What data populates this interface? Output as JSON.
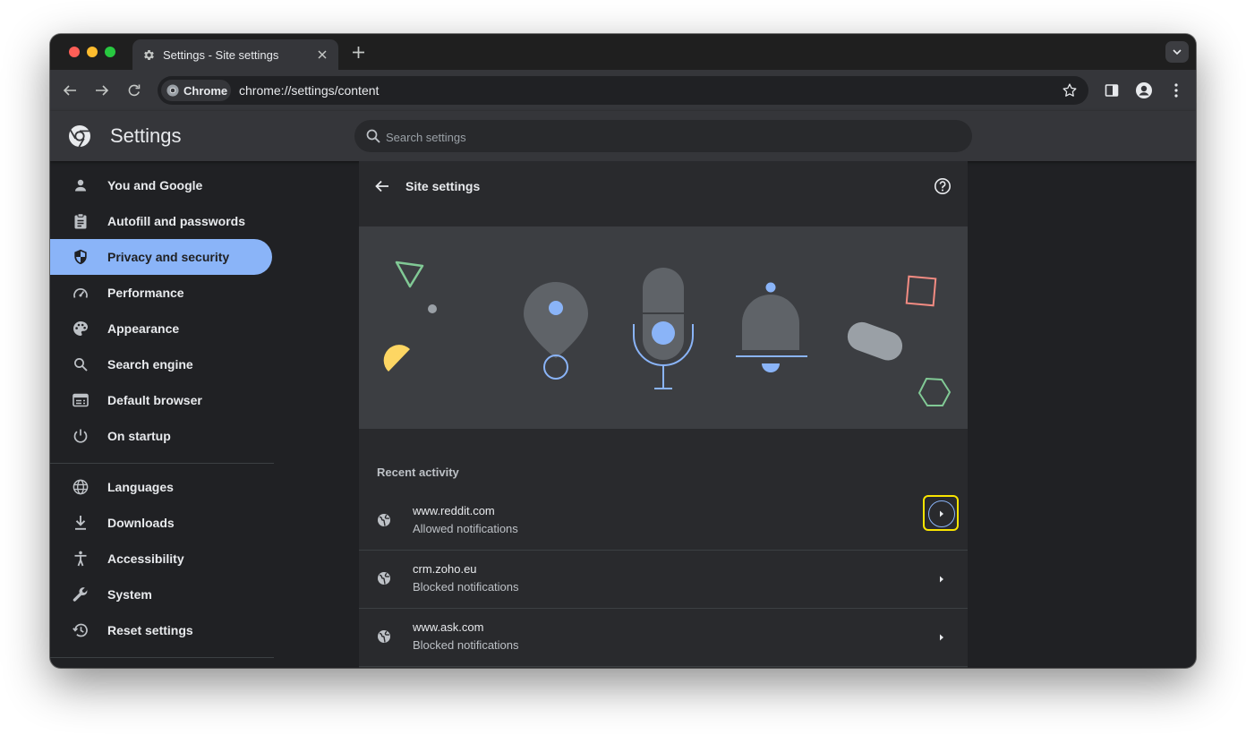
{
  "browser": {
    "tab_title": "Settings - Site settings",
    "chip_label": "Chrome",
    "url": "chrome://settings/content"
  },
  "settings": {
    "title": "Settings",
    "search_placeholder": "Search settings"
  },
  "sidebar": {
    "items": [
      {
        "label": "You and Google",
        "icon": "person-icon"
      },
      {
        "label": "Autofill and passwords",
        "icon": "clipboard-icon"
      },
      {
        "label": "Privacy and security",
        "icon": "shield-icon",
        "active": true
      },
      {
        "label": "Performance",
        "icon": "speedometer-icon"
      },
      {
        "label": "Appearance",
        "icon": "palette-icon"
      },
      {
        "label": "Search engine",
        "icon": "search-icon"
      },
      {
        "label": "Default browser",
        "icon": "browser-icon"
      },
      {
        "label": "On startup",
        "icon": "power-icon"
      },
      {
        "label": "Languages",
        "icon": "globe-icon"
      },
      {
        "label": "Downloads",
        "icon": "download-icon"
      },
      {
        "label": "Accessibility",
        "icon": "accessibility-icon"
      },
      {
        "label": "System",
        "icon": "wrench-icon"
      },
      {
        "label": "Reset settings",
        "icon": "history-icon"
      }
    ]
  },
  "content": {
    "page_title": "Site settings",
    "recent_label": "Recent activity",
    "recent": [
      {
        "site": "www.reddit.com",
        "status": "Allowed notifications"
      },
      {
        "site": "crm.zoho.eu",
        "status": "Blocked notifications"
      },
      {
        "site": "www.ask.com",
        "status": "Blocked notifications"
      }
    ]
  },
  "colors": {
    "accent": "#8ab4f8",
    "background": "#202124",
    "card": "#292a2d",
    "highlight": "#f9e400"
  }
}
